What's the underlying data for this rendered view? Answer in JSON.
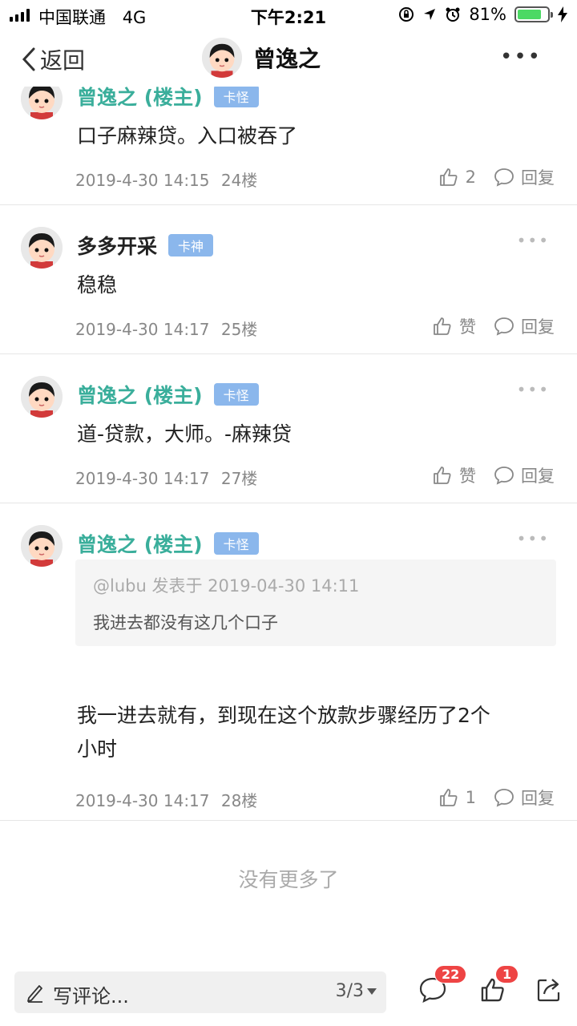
{
  "status_bar": {
    "carrier": "中国联通",
    "network": "4G",
    "time": "下午2:21",
    "battery": "81%",
    "battery_level": 0.81
  },
  "nav": {
    "back_label": "返回",
    "title": "曾逸之"
  },
  "posts": [
    {
      "user": "曾逸之 (楼主)",
      "badge": "卡怪",
      "is_op": true,
      "content": "口子麻辣贷。入口被吞了",
      "time": "2019-4-30 14:15",
      "floor": "24楼",
      "likes": "2",
      "reply": "回复"
    },
    {
      "user": "多多开采",
      "badge": "卡神",
      "is_op": false,
      "content": "稳稳",
      "time": "2019-4-30 14:17",
      "floor": "25楼",
      "likes": "赞",
      "reply": "回复"
    },
    {
      "user": "曾逸之 (楼主)",
      "badge": "卡怪",
      "is_op": true,
      "content": "道-贷款，大师。-麻辣贷",
      "time": "2019-4-30 14:17",
      "floor": "27楼",
      "likes": "赞",
      "reply": "回复"
    },
    {
      "user": "曾逸之 (楼主)",
      "badge": "卡怪",
      "is_op": true,
      "quote_header": "@lubu 发表于 2019-04-30 14:11",
      "quote_text": "我进去都没有这几个口子",
      "content_line1": "我一进去就有，到现在这个放款步骤经历了2个",
      "content_line2": "小时",
      "time": "2019-4-30 14:17",
      "floor": "28楼",
      "likes": "1",
      "reply": "回复"
    }
  ],
  "no_more": "没有更多了",
  "bottom": {
    "placeholder": "写评论...",
    "page": "3/3",
    "comment_count": "22",
    "like_count": "1"
  },
  "icons": {
    "back": "chevron-left-icon",
    "more": "more-dots-icon",
    "like": "thumb-up-icon",
    "reply": "speech-bubble-icon",
    "pen": "pen-icon",
    "share": "share-icon"
  },
  "colors": {
    "op_name": "#3aae9b",
    "badge_bg": "#8bb7ec",
    "badge_count": "#ee4444",
    "battery": "#4cd964"
  }
}
